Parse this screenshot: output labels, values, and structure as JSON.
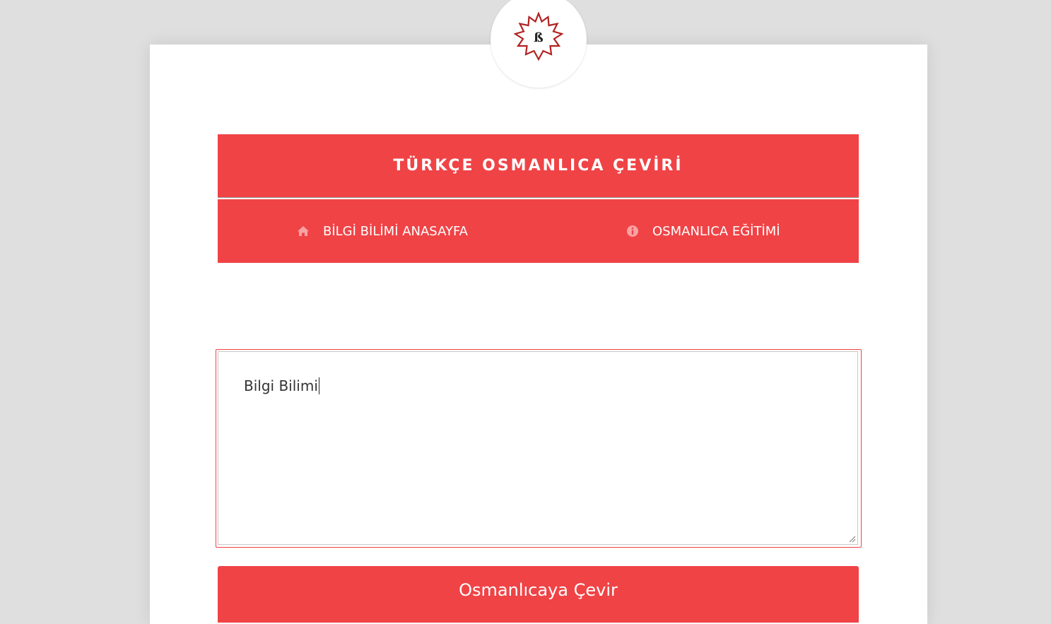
{
  "logo": {
    "glyph": "ß",
    "icon": "ottoman-seal-icon"
  },
  "header": {
    "title": "TÜRKÇE OSMANLICA ÇEVİRİ"
  },
  "nav": {
    "items": [
      {
        "label": "BİLGİ BİLİMİ ANASAYFA",
        "icon": "home-icon"
      },
      {
        "label": "OSMANLICA EĞİTİMİ",
        "icon": "info-circle-icon"
      }
    ]
  },
  "editor": {
    "value": "Bilgi Bilimi"
  },
  "actions": {
    "convert_label": "Osmanlıcaya Çevir"
  },
  "colors": {
    "accent": "#f04346",
    "background": "#dfdfdf",
    "card": "#ffffff",
    "seal": "#b22222"
  }
}
